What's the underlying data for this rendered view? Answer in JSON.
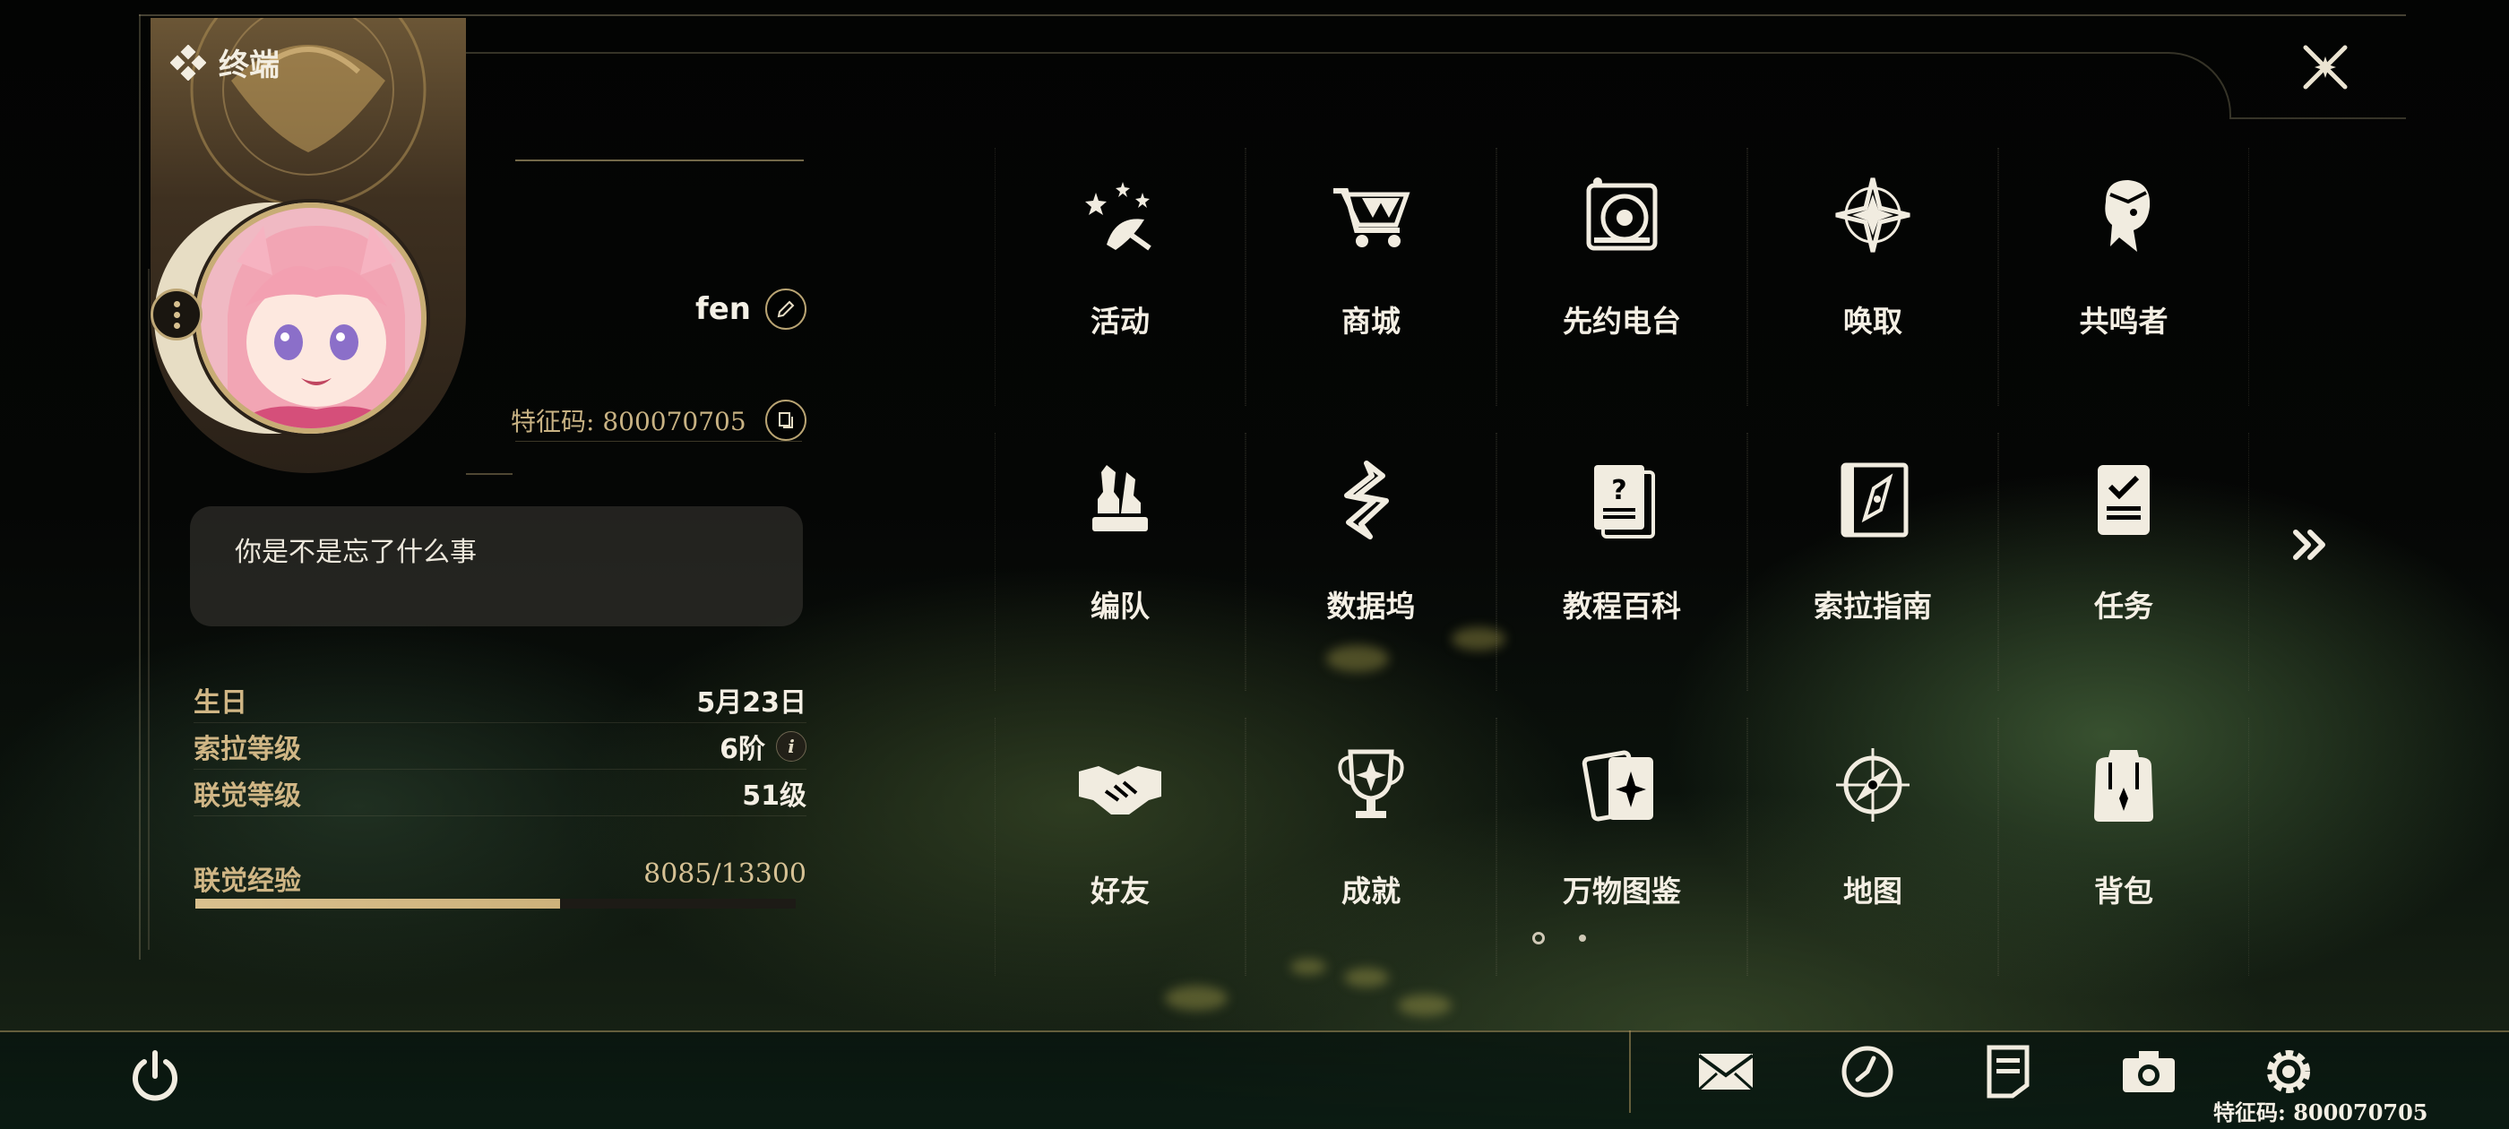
{
  "header": {
    "title": "终端"
  },
  "profile": {
    "name": "fen",
    "id_label": "特征码: 800070705",
    "signature": "你是不是忘了什么事"
  },
  "stats": [
    {
      "label": "生日",
      "value": "5月23日",
      "has_info": false
    },
    {
      "label": "索拉等级",
      "value": "6阶",
      "has_info": true
    },
    {
      "label": "联觉等级",
      "value": "51级",
      "has_info": false
    }
  ],
  "experience": {
    "label": "联觉经验",
    "value": "8085/13300",
    "current": 8085,
    "max": 13300,
    "fraction": 0.608
  },
  "menu": {
    "items": [
      {
        "label": "活动",
        "icon": "event-stars-icon"
      },
      {
        "label": "商城",
        "icon": "shop-cart-icon"
      },
      {
        "label": "先约电台",
        "icon": "radio-icon"
      },
      {
        "label": "唤取",
        "icon": "convene-compass-icon"
      },
      {
        "label": "共鸣者",
        "icon": "resonator-portrait-icon"
      },
      {
        "label": "编队",
        "icon": "team-chess-icon"
      },
      {
        "label": "数据坞",
        "icon": "data-dock-icon"
      },
      {
        "label": "教程百科",
        "icon": "tutorial-book-icon"
      },
      {
        "label": "索拉指南",
        "icon": "guidebook-icon"
      },
      {
        "label": "任务",
        "icon": "quest-checklist-icon"
      },
      {
        "label": "好友",
        "icon": "handshake-icon"
      },
      {
        "label": "成就",
        "icon": "trophy-icon"
      },
      {
        "label": "万物图鉴",
        "icon": "archive-cards-icon"
      },
      {
        "label": "地图",
        "icon": "map-compass-icon"
      },
      {
        "label": "背包",
        "icon": "backpack-icon"
      }
    ],
    "page_current": 1,
    "page_total": 2
  },
  "footer": {
    "id_label": "特征码: 800070705",
    "icons": [
      "mail-icon",
      "clock-icon",
      "notice-icon",
      "camera-icon",
      "settings-gear-icon"
    ]
  },
  "colors": {
    "accent": "#d0b685",
    "text": "#f4efe4",
    "gold": "#c8ad75"
  }
}
